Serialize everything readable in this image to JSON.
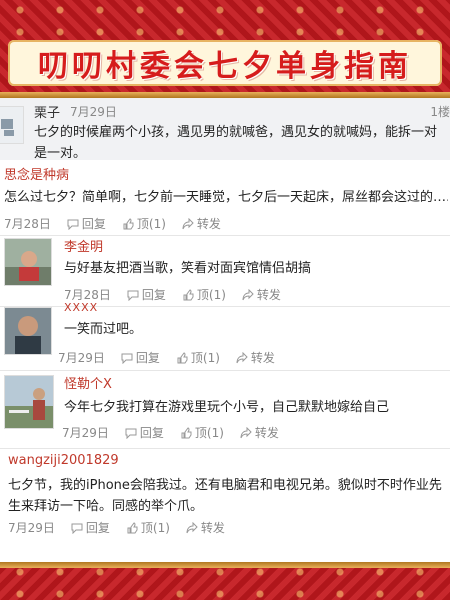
{
  "banner": {
    "title": "叨叨村委会七夕单身指南"
  },
  "posts": [
    {
      "user": "栗子",
      "date": "7月29日",
      "tag": "1楼",
      "text": "七夕的时候雇两个小孩，遇见男的就喊爸，遇见女的就喊妈，能拆一对是一对。"
    },
    {
      "user": "思念是种病",
      "text": "怎么过七夕？简单啊，七夕前一天睡觉，七夕后一天起床，屌丝都会这过的……",
      "date": "7月28日",
      "reply": "回复",
      "like": "顶(1)",
      "share": "转发"
    },
    {
      "user": "李金明",
      "text": "与好基友把酒当歌，笑看对面宾馆情侣胡搞",
      "date": "7月28日",
      "reply": "回复",
      "like": "顶(1)",
      "share": "转发"
    },
    {
      "user": "XXXX",
      "text": "一笑而过吧。",
      "date": "7月29日",
      "reply": "回复",
      "like": "顶(1)",
      "share": "转发"
    },
    {
      "user": "怪勒个X",
      "text": "今年七夕我打算在游戏里玩个小号，自己默默地嫁给自己",
      "date": "7月29日",
      "reply": "回复",
      "like": "顶(1)",
      "share": "转发"
    },
    {
      "user": "wangziji2001829",
      "text": "七夕节，我的iPhone会陪我过。还有电脑君和电视兄弟。貌似时不时作业先生来拜访一下哈。同感的举个爪。",
      "date": "7月29日",
      "reply": "回复",
      "like": "顶(1)",
      "share": "转发"
    }
  ],
  "colors": {
    "username": "#c0392b",
    "frame": "#b0161b",
    "title": "#d61c1c"
  },
  "icons": [
    "reply-icon",
    "like-icon",
    "share-icon"
  ]
}
